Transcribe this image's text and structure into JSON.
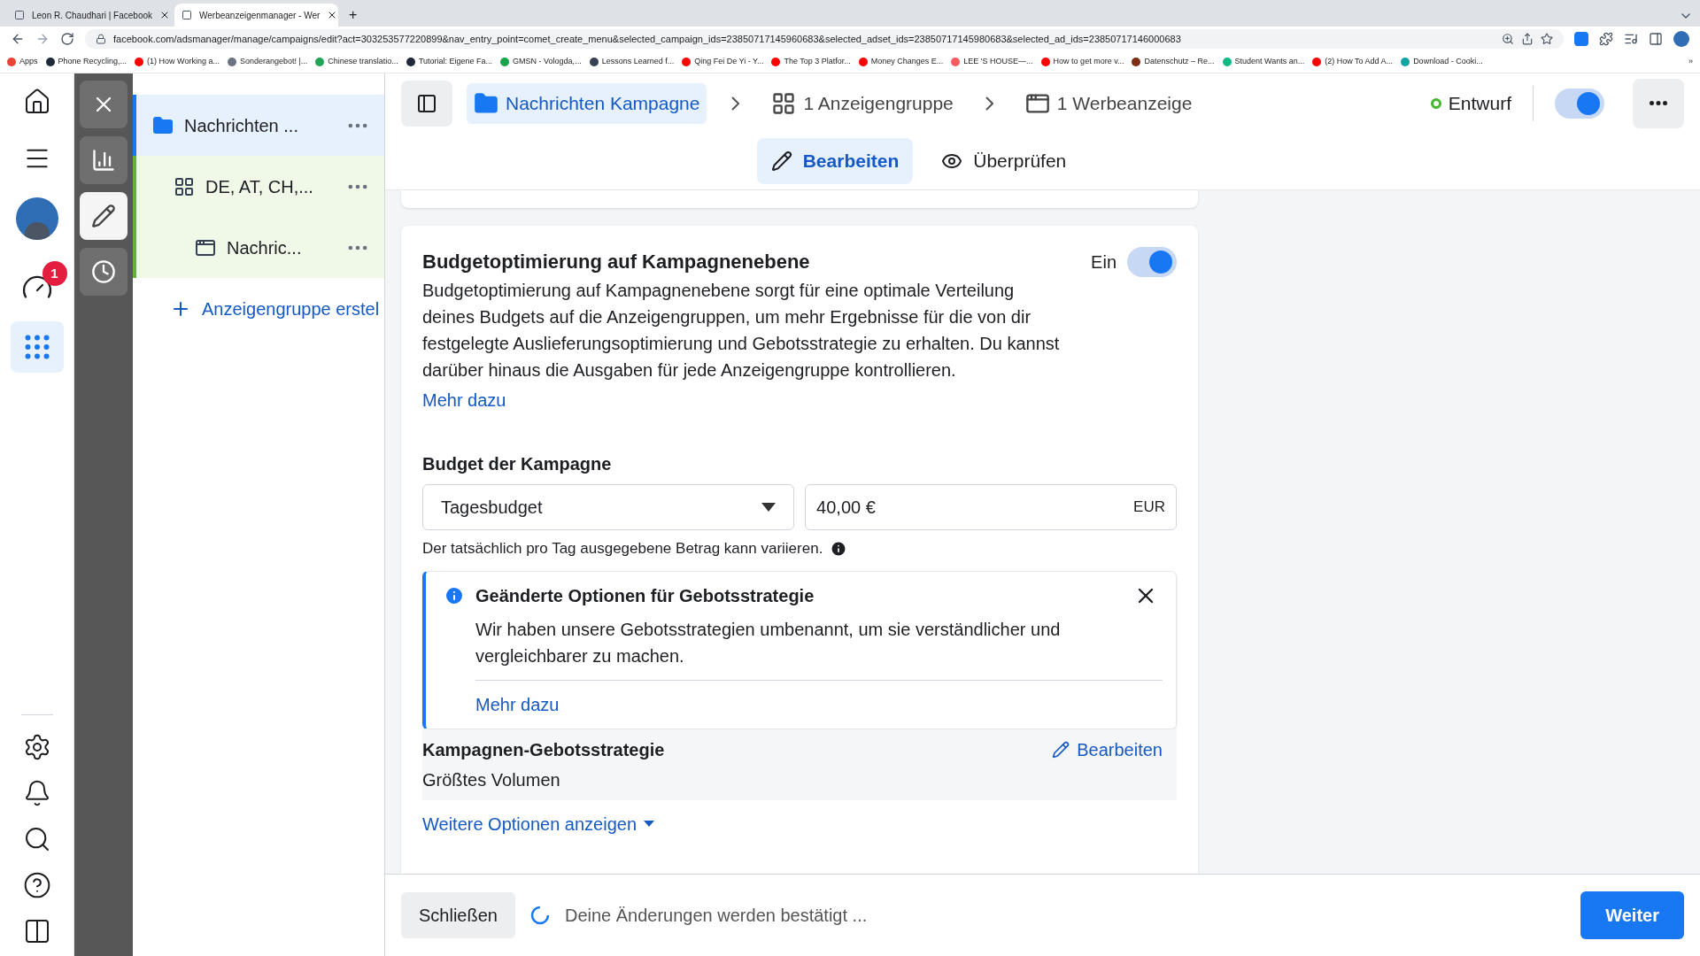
{
  "browser": {
    "tabs": [
      {
        "title": "Leon R. Chaudhari | Facebook",
        "selected": false
      },
      {
        "title": "Werbeanzeigenmanager - Wer",
        "selected": true
      }
    ],
    "new_tab": "+",
    "url": "facebook.com/adsmanager/manage/campaigns/edit?act=303253577220899&nav_entry_point=comet_create_menu&selected_campaign_ids=23850717145960683&selected_adset_ids=23850717145980683&selected_ad_ids=23850717146000683",
    "bookmarks": [
      {
        "label": "Apps",
        "color": "#ea4335"
      },
      {
        "label": "Phone Recycling,...",
        "color": "#1f2937"
      },
      {
        "label": "(1) How Working a...",
        "color": "#ff0000"
      },
      {
        "label": "Sonderangebot! |...",
        "color": "#6b7280"
      },
      {
        "label": "Chinese translatio...",
        "color": "#22a559"
      },
      {
        "label": "Tutorial: Eigene Fa...",
        "color": "#1f2937"
      },
      {
        "label": "GMSN - Vologda,...",
        "color": "#16a34a"
      },
      {
        "label": "Lessons Learned f...",
        "color": "#374151"
      },
      {
        "label": "Qing Fei De Yi - Y...",
        "color": "#ff0000"
      },
      {
        "label": "The Top 3 Platfor...",
        "color": "#ff0000"
      },
      {
        "label": "Money Changes E...",
        "color": "#ff0000"
      },
      {
        "label": "LEE 'S HOUSE—...",
        "color": "#ff5a5f"
      },
      {
        "label": "How to get more v...",
        "color": "#ff0000"
      },
      {
        "label": "Datenschutz – Re...",
        "color": "#7c2d12"
      },
      {
        "label": "Student Wants an...",
        "color": "#10b981"
      },
      {
        "label": "(2) How To Add A...",
        "color": "#ff0000"
      },
      {
        "label": "Download - Cooki...",
        "color": "#0ea5a4"
      }
    ],
    "more": "»"
  },
  "rail": {
    "badge": "1"
  },
  "tool_strip": [
    {
      "kind": "close",
      "selected": false
    },
    {
      "kind": "chart",
      "selected": false
    },
    {
      "kind": "edit",
      "selected": true
    },
    {
      "kind": "history",
      "selected": false
    }
  ],
  "tree": {
    "items": [
      {
        "label": "Nachrichten ...",
        "kind": "campaign",
        "selected": true,
        "children": [
          {
            "label": "DE, AT, CH,...",
            "kind": "adset",
            "selected": false,
            "children": [
              {
                "label": "Nachric...",
                "kind": "ad",
                "selected": false
              }
            ]
          }
        ]
      }
    ],
    "add_link": "Anzeigengruppe erstel"
  },
  "header": {
    "breadcrumbs": [
      {
        "label": "Nachrichten Kampagne",
        "kind": "campaign",
        "selected": true
      },
      {
        "label": "1 Anzeigengruppe",
        "kind": "adset",
        "selected": false
      },
      {
        "label": "1 Werbeanzeige",
        "kind": "ad",
        "selected": false
      }
    ],
    "status": "Entwurf",
    "on": true
  },
  "view_tabs": [
    {
      "label": "Bearbeiten",
      "selected": true
    },
    {
      "label": "Überprüfen",
      "selected": false
    }
  ],
  "budget_optimization": {
    "title": "Budgetoptimierung auf Kampagnenebene",
    "toggle_label": "Ein",
    "on": true,
    "description": "Budgetoptimierung auf Kampagnenebene sorgt für eine optimale Verteilung deines Budgets auf die Anzeigengruppen, um mehr Ergebnisse für die von dir festgelegte Auslieferungsoptimierung und Gebotsstrategie zu erhalten. Du kannst darüber hinaus die Ausgaben für jede Anzeigengruppe kontrollieren.",
    "link": "Mehr dazu"
  },
  "budget": {
    "label": "Budget der Kampagne",
    "type": "Tagesbudget",
    "amount": "40,00 €",
    "currency": "EUR",
    "note": "Der tatsächlich pro Tag ausgegebene Betrag kann variieren."
  },
  "notice": {
    "title": "Geänderte Optionen für Gebotsstrategie",
    "body": "Wir haben unsere Gebotsstrategien umbenannt, um sie verständlicher und vergleichbarer zu machen.",
    "link": "Mehr dazu"
  },
  "bid_strategy": {
    "label": "Kampagnen-Gebotsstrategie",
    "edit": "Bearbeiten",
    "value": "Größtes Volumen"
  },
  "more_options": "Weitere Optionen anzeigen",
  "footer": {
    "close": "Schließen",
    "status": "Deine Änderungen werden bestätigt ...",
    "next": "Weiter"
  }
}
